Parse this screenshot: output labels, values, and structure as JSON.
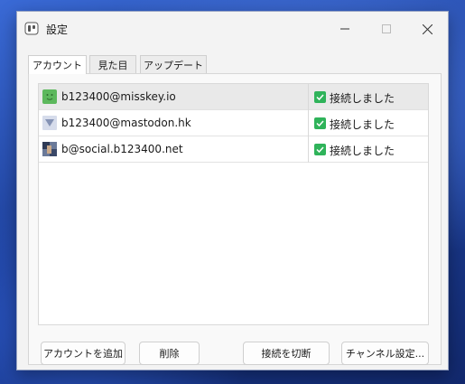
{
  "window": {
    "title": "設定",
    "app_icon": "app-icon",
    "controls": [
      "minimize-icon",
      "maximize-icon",
      "close-icon"
    ]
  },
  "tabs": [
    {
      "label": "アカウント",
      "active": true
    },
    {
      "label": "見た目",
      "active": false
    },
    {
      "label": "アップデート",
      "active": false
    }
  ],
  "accounts": [
    {
      "name": "b123400@misskey.io",
      "status": "接続しました",
      "selected": true,
      "avatar_color": "#5cb85c"
    },
    {
      "name": "b123400@mastodon.hk",
      "status": "接続しました",
      "selected": false,
      "avatar_color": "#9aa7c8"
    },
    {
      "name": "b@social.b123400.net",
      "status": "接続しました",
      "selected": false,
      "avatar_color": "#4a5b7a"
    }
  ],
  "buttons": {
    "add_account": "アカウントを追加",
    "delete": "削除",
    "disconnect": "接続を切断",
    "channel_settings": "チャンネル設定..."
  },
  "colors": {
    "check_green": "#2fb35a",
    "selected_row": "#e9e9e9"
  }
}
